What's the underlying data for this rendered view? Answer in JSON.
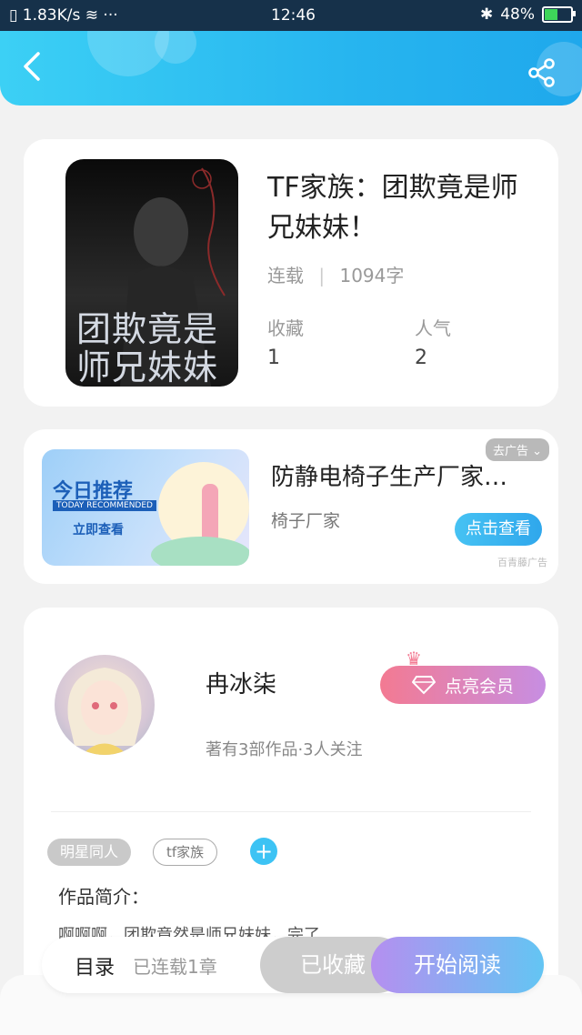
{
  "status_bar": {
    "speed": "1.83K/s",
    "time": "12:46",
    "battery": "48%",
    "battery_level": 0.48
  },
  "header": {
    "back_icon": "chevron-left-icon",
    "share_icon": "share-icon"
  },
  "book": {
    "title": "TF家族：团欺竟是师兄妹妹！",
    "cover_text": "团欺竟是师兄妹妹",
    "status": "连载",
    "word_count": "1094字",
    "favorites_label": "收藏",
    "favorites_value": "1",
    "popularity_label": "人气",
    "popularity_value": "2"
  },
  "ad": {
    "image_title": "今日推荐",
    "image_subtitle": "TODAY RECOMMENDED",
    "image_cta": "立即查看",
    "title": "防静电椅子生产厂家…",
    "subtitle": "椅子厂家",
    "tag": "去广告",
    "button": "点击查看",
    "source": "百青藤广告"
  },
  "author": {
    "name": "冉冰柒",
    "info": "著有3部作品·3人关注",
    "vip_button": "点亮会员",
    "tags": [
      "明星同人",
      "tf家族"
    ],
    "intro_label": "作品简介：",
    "intro": "啊啊啊，团欺竟然是师兄妹妹，完了"
  },
  "bottom_bar": {
    "toc": "目录",
    "progress": "已连载1章",
    "favorited": "已收藏",
    "read": "开始阅读"
  },
  "colors": {
    "header": "#27b5ef",
    "accent": "#3dc3f4",
    "vip_start": "#f37a92",
    "vip_end": "#c78ee2"
  }
}
